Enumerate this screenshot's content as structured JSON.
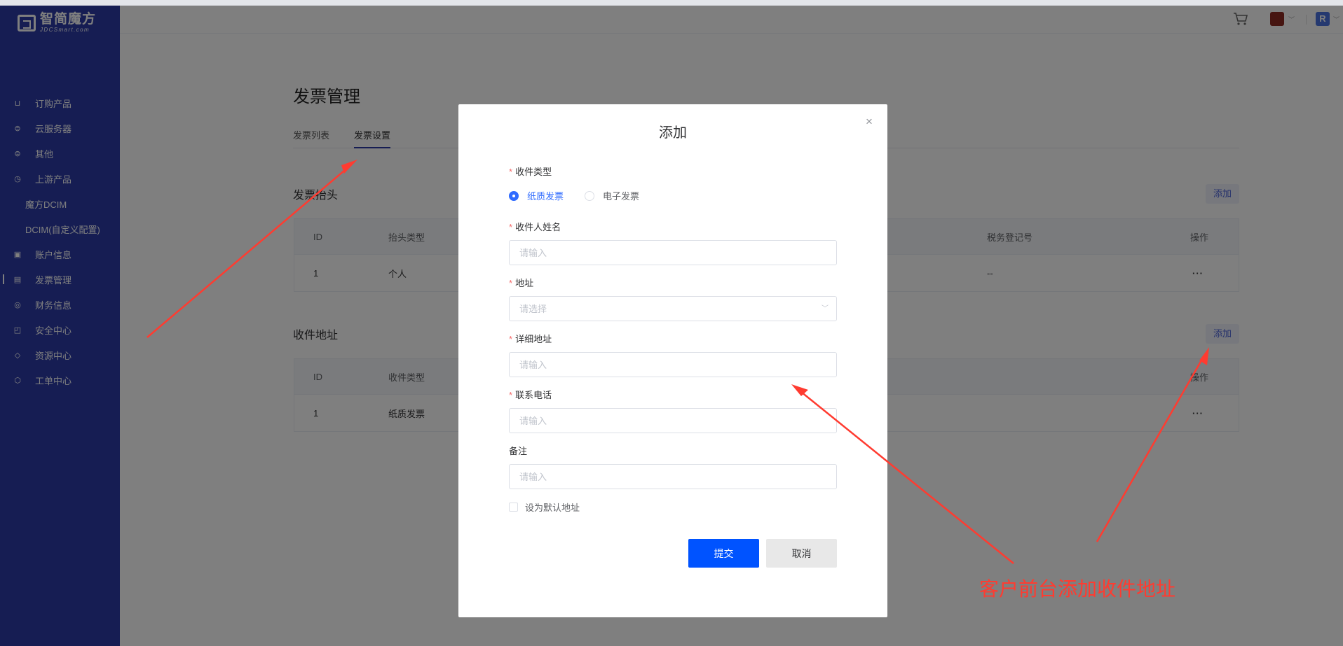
{
  "brand": {
    "name_cn": "智简魔方",
    "name_en": "JDCSmart.com"
  },
  "sidebar": {
    "items": [
      {
        "label": "订购产品",
        "icon": "cart-icon",
        "glyph": "⊔"
      },
      {
        "label": "云服务器",
        "icon": "server-icon",
        "glyph": "⊜"
      },
      {
        "label": "其他",
        "icon": "stack-icon",
        "glyph": "⊜"
      },
      {
        "label": "上游产品",
        "icon": "clock-icon",
        "glyph": "◷"
      },
      {
        "label": "魔方DCIM",
        "icon": "",
        "glyph": ""
      },
      {
        "label": "DCIM(自定义配置)",
        "icon": "",
        "glyph": ""
      },
      {
        "label": "账户信息",
        "icon": "account-icon",
        "glyph": "▣"
      },
      {
        "label": "发票管理",
        "icon": "invoice-icon",
        "glyph": "▤"
      },
      {
        "label": "财务信息",
        "icon": "finance-icon",
        "glyph": "◎"
      },
      {
        "label": "安全中心",
        "icon": "lock-icon",
        "glyph": "◰"
      },
      {
        "label": "资源中心",
        "icon": "tag-icon",
        "glyph": "◇"
      },
      {
        "label": "工单中心",
        "icon": "cube-icon",
        "glyph": "⬡"
      }
    ]
  },
  "header": {
    "avatar_letter": "R"
  },
  "page": {
    "title": "发票管理",
    "tabs": [
      "发票列表",
      "发票设置"
    ],
    "invoice_header": {
      "title": "发票抬头",
      "add_label": "添加",
      "columns": [
        "ID",
        "抬头类型",
        "税务登记号",
        "操作"
      ],
      "rows": [
        {
          "id": "1",
          "type": "个人",
          "tax": "--",
          "action": "···"
        }
      ]
    },
    "address": {
      "title": "收件地址",
      "add_label": "添加",
      "columns": [
        "ID",
        "收件类型",
        "操作"
      ],
      "rows": [
        {
          "id": "1",
          "type": "纸质发票",
          "action": "···"
        }
      ]
    }
  },
  "modal": {
    "title": "添加",
    "close": "×",
    "type_label": "收件类型",
    "type_options": [
      "纸质发票",
      "电子发票"
    ],
    "name_label": "收件人姓名",
    "name_placeholder": "请输入",
    "region_label": "地址",
    "region_placeholder": "请选择",
    "detail_label": "详细地址",
    "detail_placeholder": "请输入",
    "phone_label": "联系电话",
    "phone_placeholder": "请输入",
    "remark_label": "备注",
    "remark_placeholder": "请输入",
    "default_label": "设为默认地址",
    "submit": "提交",
    "cancel": "取消"
  },
  "annotation": {
    "text": "客户前台添加收件地址",
    "color": "#ff3b30"
  }
}
